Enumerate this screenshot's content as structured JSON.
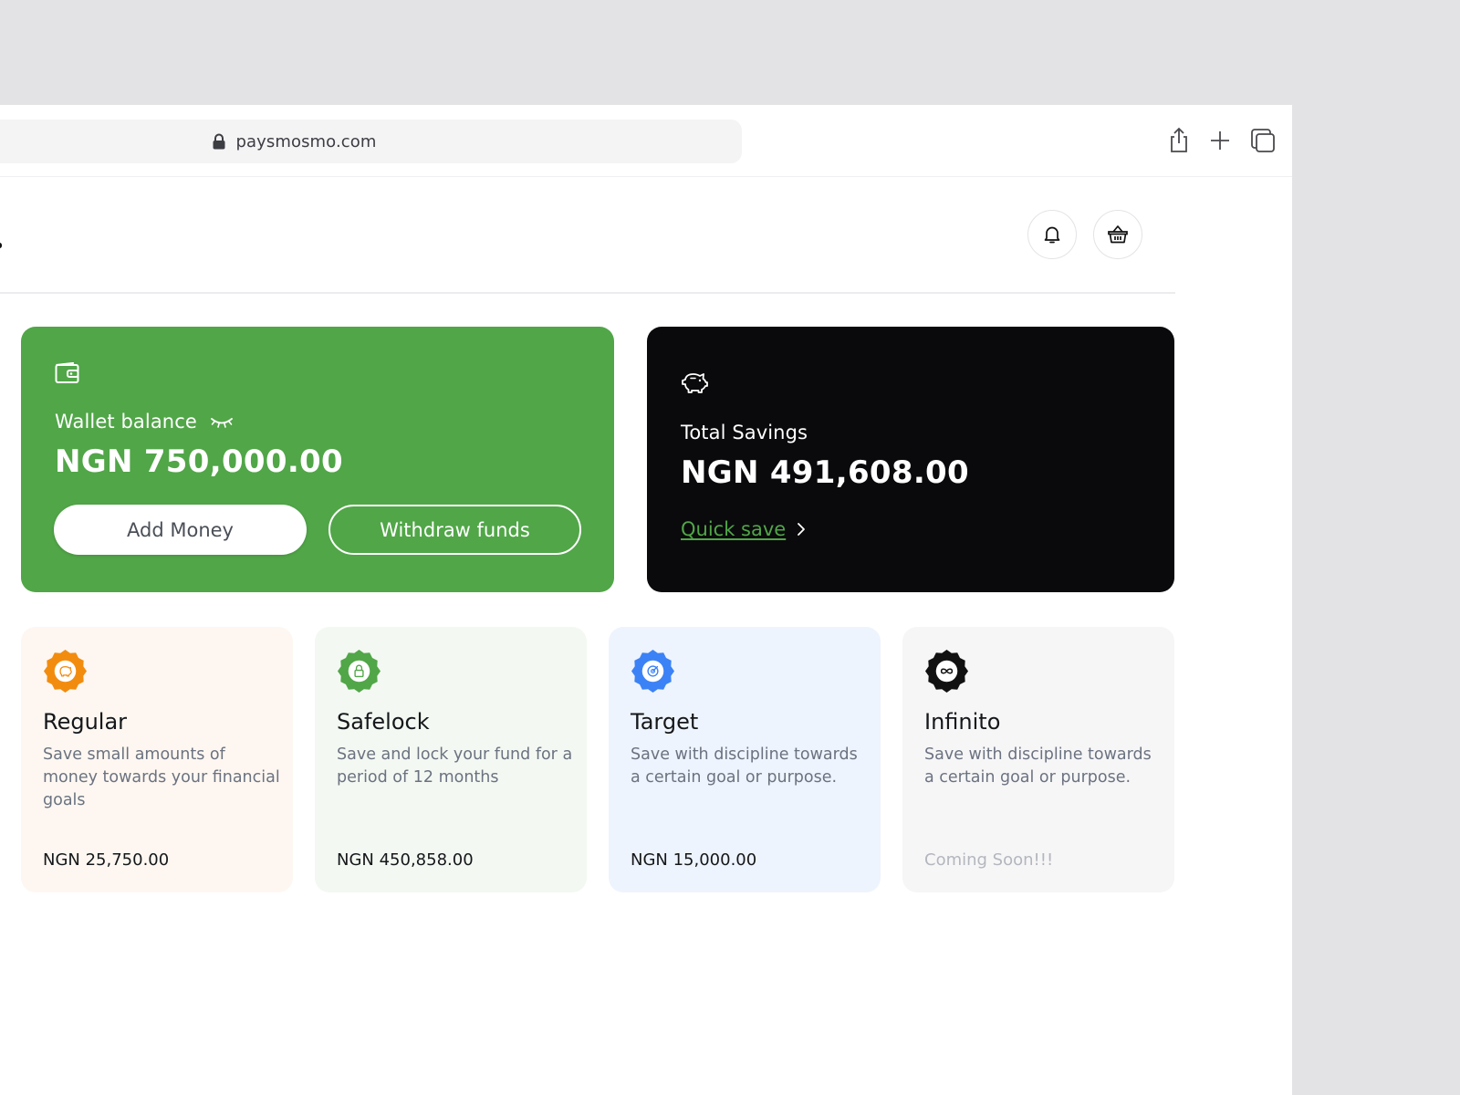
{
  "browser": {
    "url": "paysmosmo.com"
  },
  "wallet": {
    "label": "Wallet balance",
    "amount": "NGN 750,000.00",
    "add_money_label": "Add Money",
    "withdraw_label": "Withdraw funds",
    "color": "#51a648"
  },
  "savings": {
    "label": "Total Savings",
    "amount": "NGN 491,608.00",
    "quick_save_label": "Quick save",
    "color": "#0a0a0c"
  },
  "plans": [
    {
      "title": "Regular",
      "description": "Save small amounts of money towards your financial goals",
      "amount": "NGN 25,750.00",
      "icon": "piggy-badge-icon",
      "bg": "#fef7f1",
      "accent": "#f28c0f"
    },
    {
      "title": "Safelock",
      "description": "Save and lock your fund for a period of 12 months",
      "amount": "NGN 450,858.00",
      "icon": "lock-badge-icon",
      "bg": "#f3f8f2",
      "accent": "#51a648"
    },
    {
      "title": "Target",
      "description": "Save with discipline towards a certain goal or purpose.",
      "amount": "NGN 15,000.00",
      "icon": "target-badge-icon",
      "bg": "#eef4fd",
      "accent": "#3b82f6"
    },
    {
      "title": "Infinito",
      "description": "Save with discipline towards a certain goal or purpose.",
      "amount": "Coming Soon!!!",
      "icon": "infinity-badge-icon",
      "bg": "#f6f6f7",
      "accent": "#111111"
    }
  ]
}
